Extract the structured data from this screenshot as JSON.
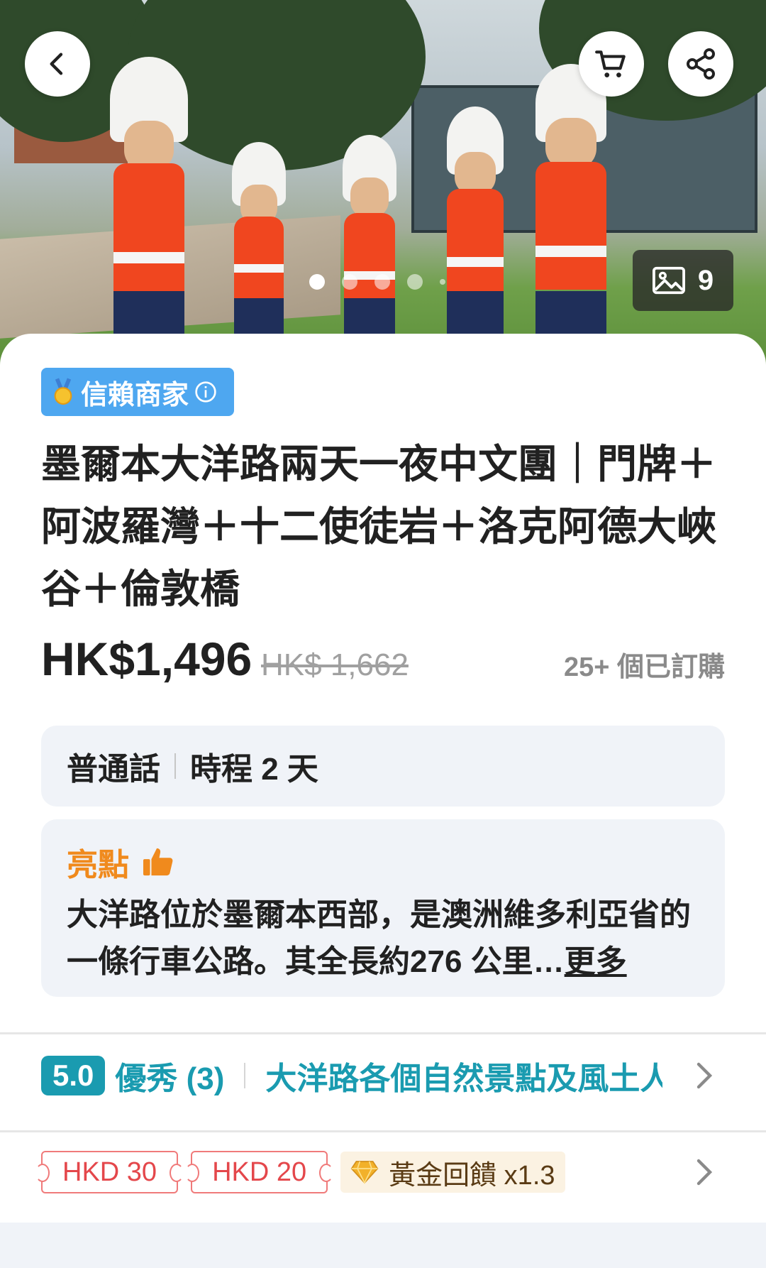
{
  "hero": {
    "photo_count": "9",
    "carousel_total": 5,
    "carousel_active_index": 0
  },
  "badge": {
    "label": "信賴商家"
  },
  "product": {
    "title": "墨爾本大洋路兩天一夜中文團｜門牌＋阿波羅灣＋十二使徒岩＋洛克阿德大峽谷＋倫敦橋",
    "price": "HK$1,496",
    "original_price": "HK$ 1,662",
    "sold": "25+ 個已訂購"
  },
  "info": {
    "language": "普通話",
    "duration": "時程 2 天"
  },
  "highlights": {
    "title": "亮點",
    "text": "大洋路位於墨爾本西部，是澳洲維多利亞省的一條行車公路。其全長約276 公里…",
    "more": "更多"
  },
  "rating": {
    "score": "5.0",
    "label": "優秀 (3)",
    "snippet": "大洋路各個自然景點及風土人情"
  },
  "promos": {
    "coupons": [
      "HKD 30",
      "HKD 20"
    ],
    "gold_label": "黃金回饋 x1.3"
  },
  "colors": {
    "accent_teal": "#1a9bb0",
    "badge_blue": "#4ea7f0",
    "highlight_orange": "#f08a1d",
    "coupon_red": "#e4474b"
  }
}
